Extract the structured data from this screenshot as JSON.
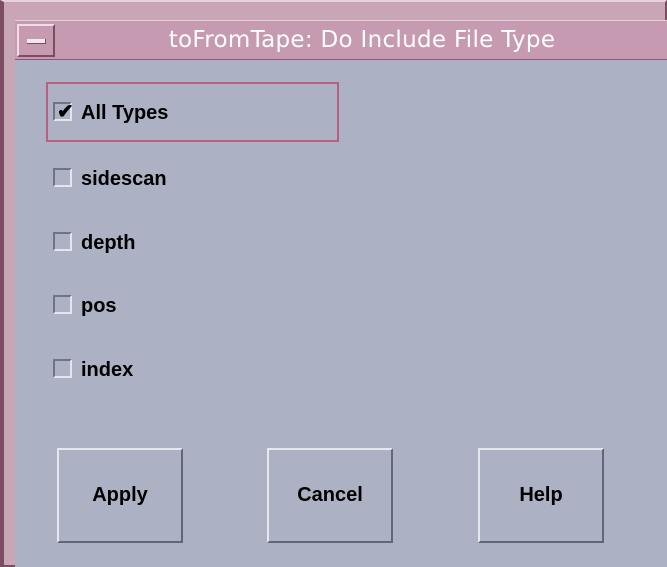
{
  "window": {
    "title": "toFromTape: Do Include File Type"
  },
  "options": [
    {
      "label": "All Types",
      "checked": true
    },
    {
      "label": "sidescan",
      "checked": false
    },
    {
      "label": "depth",
      "checked": false
    },
    {
      "label": "pos",
      "checked": false
    },
    {
      "label": "index",
      "checked": false
    }
  ],
  "buttons": {
    "apply": "Apply",
    "cancel": "Cancel",
    "help": "Help"
  },
  "colors": {
    "titlebar": "#c69ab0",
    "client_bg": "#adb1c4",
    "focus": "#b9607e"
  }
}
